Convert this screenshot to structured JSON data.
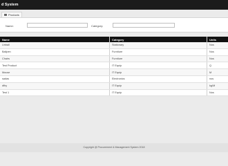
{
  "app": {
    "title": "d System"
  },
  "tab": {
    "label": "Products"
  },
  "filters": {
    "name_label": "Name:",
    "name_value": "",
    "category_label": "Category:",
    "category_value": ""
  },
  "table": {
    "headers": [
      "Name",
      "Category",
      "Units"
    ],
    "rows": [
      [
        "Unball",
        "Stationary",
        "Nos"
      ],
      [
        "Ballpen",
        "Furniture",
        "Nos"
      ],
      [
        "Chairs",
        "Furniture",
        "Nos"
      ],
      [
        "Test Product",
        "IT Equip",
        "Q"
      ],
      [
        "Mouse",
        "IT Equip",
        "M"
      ],
      [
        "sadas",
        "Electronics",
        "nos"
      ],
      [
        "dfhy",
        "IT Equip",
        "kg/M"
      ],
      [
        "Test 1",
        "IT Equip",
        "Nos"
      ]
    ]
  },
  "footer": {
    "text": "Copyright @ Procurement & Management System 2018"
  }
}
